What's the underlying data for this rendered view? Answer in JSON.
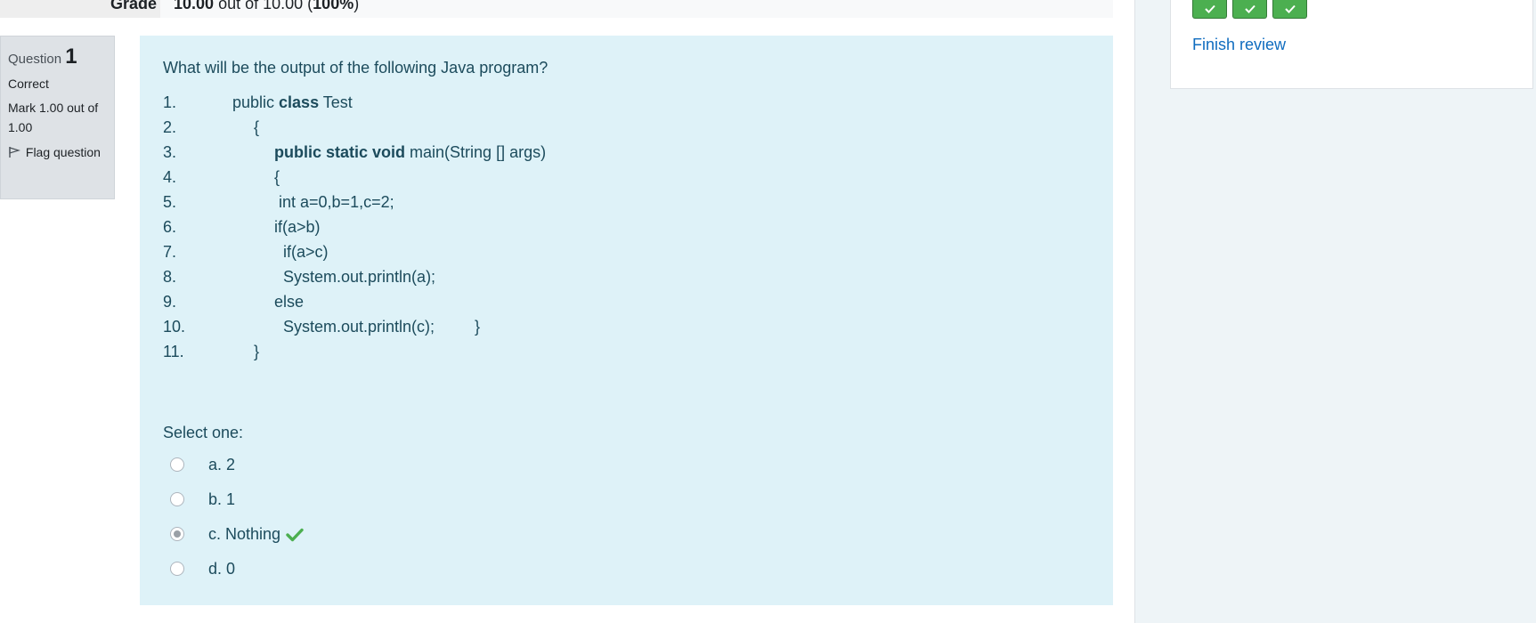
{
  "grade": {
    "label": "Grade",
    "score": "10.00",
    "out_of_text": "out of 10.00",
    "percent_open": "(",
    "percent": "100%",
    "percent_close": ")"
  },
  "nav": {
    "finish_review": "Finish review",
    "check_icon": "check-icon"
  },
  "question_info": {
    "question_word": "Question",
    "number": "1",
    "state": "Correct",
    "mark": "Mark 1.00 out of 1.00",
    "flag_label": "Flag question",
    "flag_icon": "flag-icon"
  },
  "question": {
    "text": "What will be the output of the following Java program?",
    "code_lines": [
      {
        "num": "1.",
        "pre": "public ",
        "bold": "class",
        "post": " Test"
      },
      {
        "num": "2.",
        "pre": "{",
        "bold": "",
        "post": ""
      },
      {
        "num": "3.",
        "pre": "",
        "bold": "public static void",
        "post": " main(String [] args)"
      },
      {
        "num": "4.",
        "pre": "{",
        "bold": "",
        "post": ""
      },
      {
        "num": "5.",
        "pre": " int a=0,b=1,c=2;",
        "bold": "",
        "post": ""
      },
      {
        "num": "6.",
        "pre": "if(a>b)",
        "bold": "",
        "post": ""
      },
      {
        "num": "7.",
        "pre": "if(a>c)",
        "bold": "",
        "post": ""
      },
      {
        "num": "8.",
        "pre": "System.out.println(a);",
        "bold": "",
        "post": ""
      },
      {
        "num": "9.",
        "pre": "else",
        "bold": "",
        "post": ""
      },
      {
        "num": "10.",
        "pre": "System.out.println(c);         }",
        "bold": "",
        "post": ""
      },
      {
        "num": "11.",
        "pre": "}",
        "bold": "",
        "post": ""
      }
    ],
    "select_one": "Select one:",
    "answers": [
      {
        "label": "a. 2",
        "checked": false
      },
      {
        "label": "b. 1",
        "checked": false
      },
      {
        "label": "c. Nothing",
        "checked": true,
        "correct_icon": "check-icon"
      },
      {
        "label": "d. 0",
        "checked": false
      }
    ]
  },
  "colors": {
    "content_bg": "#def2f8",
    "content_text": "#1c4b5c",
    "link": "#0f6cbf",
    "correct_green": "#4caf50"
  }
}
